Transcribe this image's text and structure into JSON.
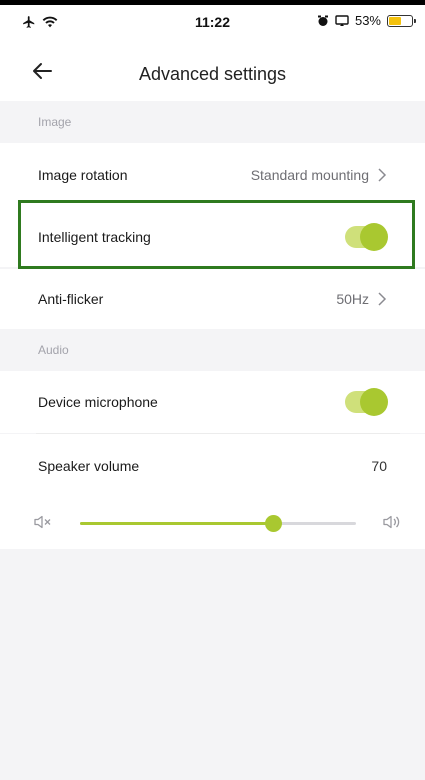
{
  "status_bar": {
    "time": "11:22",
    "battery_percent_label": "53%",
    "battery_level": 0.53,
    "icons": [
      "airplane-icon",
      "wifi-icon",
      "alarm-icon",
      "screen-mirror-icon",
      "battery-icon"
    ]
  },
  "nav": {
    "back_icon": "arrow-left-icon",
    "title": "Advanced settings"
  },
  "sections": {
    "image": {
      "header": "Image"
    },
    "audio": {
      "header": "Audio"
    }
  },
  "settings": {
    "image_rotation": {
      "label": "Image rotation",
      "value": "Standard mounting"
    },
    "intelligent_tracking": {
      "label": "Intelligent tracking",
      "enabled": true
    },
    "anti_flicker": {
      "label": "Anti-flicker",
      "value": "50Hz"
    },
    "device_microphone": {
      "label": "Device microphone",
      "enabled": true
    },
    "speaker_volume": {
      "label": "Speaker volume",
      "value": "70",
      "level": 70,
      "max": 100
    }
  },
  "colors": {
    "accent": "#a9c830",
    "accent_light": "#cfe07a",
    "highlight_border": "#2f7a1f"
  }
}
